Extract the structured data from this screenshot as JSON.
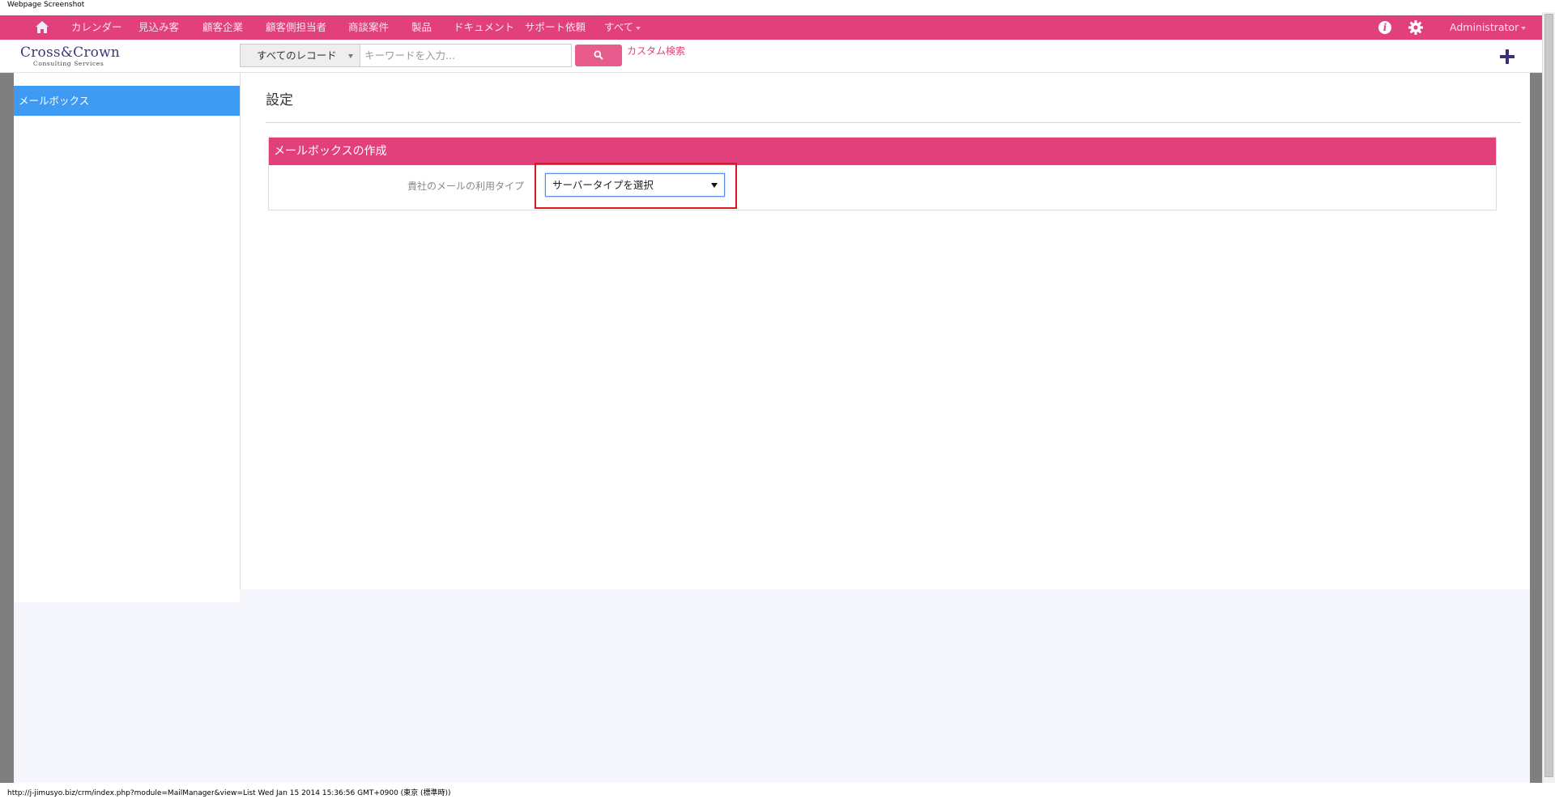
{
  "window": {
    "caption": "Webpage Screenshot"
  },
  "topnav": {
    "items": [
      {
        "label": "カレンダー"
      },
      {
        "label": "見込み客"
      },
      {
        "label": "顧客企業"
      },
      {
        "label": "顧客側担当者"
      },
      {
        "label": "商談案件"
      },
      {
        "label": "製品"
      },
      {
        "label": "ドキュメント"
      },
      {
        "label": "サポート依頼"
      },
      {
        "label": "すべて"
      }
    ],
    "user": "Administrator",
    "background_color": "#e2407a"
  },
  "header": {
    "logo": {
      "line1": "Cross&Crown",
      "line2": "Consulting Services"
    },
    "search": {
      "scope": "すべてのレコード",
      "placeholder": "キーワードを入力..."
    },
    "custom_search": "カスタム検索"
  },
  "sidebar": {
    "items": [
      {
        "label": "メールボックス",
        "selected": true
      }
    ]
  },
  "main": {
    "title": "設定",
    "panel": {
      "heading": "メールボックスの作成",
      "field_label": "貴社のメールの利用タイプ",
      "select_value": "サーバータイプを選択"
    }
  },
  "statusbar": {
    "text": "http://j-jimusyo.biz/crm/index.php?module=MailManager&view=List Wed Jan 15 2014 15:36:56 GMT+0900 (東京 (標準時))"
  },
  "colors": {
    "accent": "#e2407a",
    "selected": "#3d9bf3",
    "highlight": "#e0161f"
  }
}
